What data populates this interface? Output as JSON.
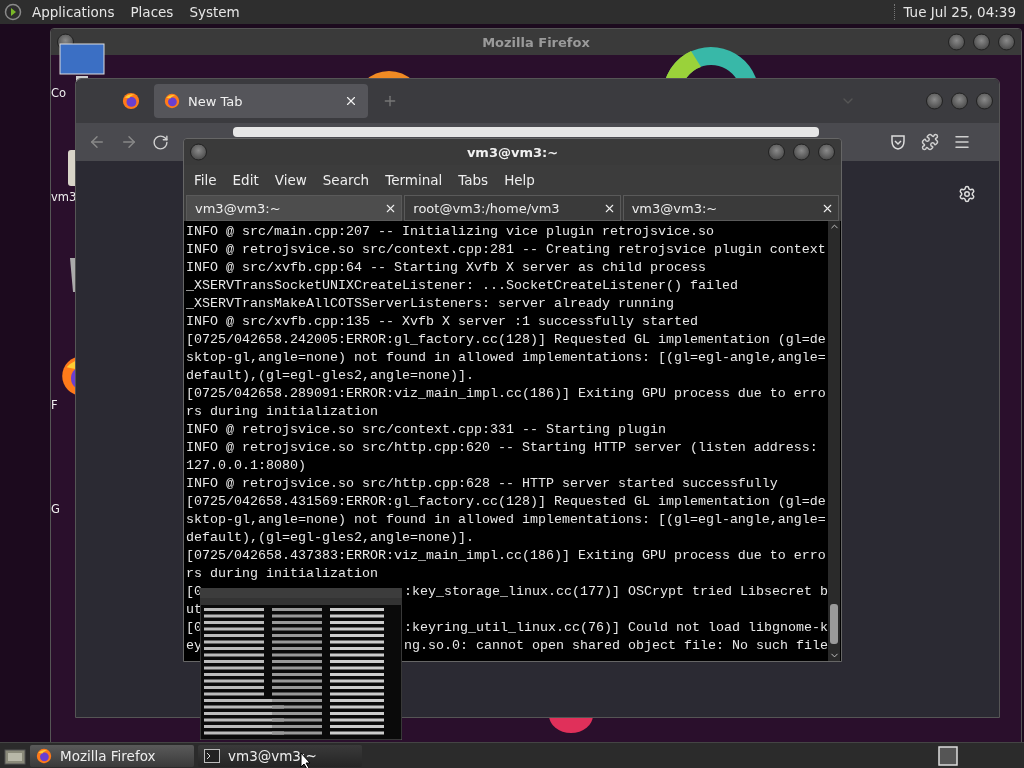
{
  "top_panel": {
    "menus": [
      "Applications",
      "Places",
      "System"
    ],
    "clock": "Tue Jul 25, 04:39"
  },
  "desktop_icons": [
    {
      "kind": "computer",
      "label": "Co"
    },
    {
      "kind": "drive",
      "label": "vm3"
    },
    {
      "kind": "trash"
    },
    {
      "kind": "firefox",
      "label": "F"
    },
    {
      "kind": "blank",
      "label": "G"
    }
  ],
  "back_window": {
    "title": "Mozilla Firefox"
  },
  "firefox": {
    "tabs": [
      {
        "label": "New Tab",
        "selected": true
      }
    ]
  },
  "terminal": {
    "title": "vm3@vm3:~",
    "menu": [
      "File",
      "Edit",
      "View",
      "Search",
      "Terminal",
      "Tabs",
      "Help"
    ],
    "tabs": [
      {
        "label": "vm3@vm3:~",
        "selected": true
      },
      {
        "label": "root@vm3:/home/vm3",
        "selected": false
      },
      {
        "label": "vm3@vm3:~",
        "selected": false
      }
    ],
    "lines": [
      "INFO @ src/main.cpp:207 -- Initializing vice plugin retrojsvice.so",
      "INFO @ retrojsvice.so src/context.cpp:281 -- Creating retrojsvice plugin context",
      "INFO @ src/xvfb.cpp:64 -- Starting Xvfb X server as child process",
      "_XSERVTransSocketUNIXCreateListener: ...SocketCreateListener() failed",
      "_XSERVTransMakeAllCOTSServerListeners: server already running",
      "INFO @ src/xvfb.cpp:135 -- Xvfb X server :1 successfully started",
      "[0725/042658.242005:ERROR:gl_factory.cc(128)] Requested GL implementation (gl=de",
      "sktop-gl,angle=none) not found in allowed implementations: [(gl=egl-angle,angle=",
      "default),(gl=egl-gles2,angle=none)].",
      "[0725/042658.289091:ERROR:viz_main_impl.cc(186)] Exiting GPU process due to erro",
      "rs during initialization",
      "INFO @ retrojsvice.so src/context.cpp:331 -- Starting plugin",
      "INFO @ retrojsvice.so src/http.cpp:620 -- Starting HTTP server (listen address:",
      "127.0.0.1:8080)",
      "INFO @ retrojsvice.so src/http.cpp:628 -- HTTP server started successfully",
      "[0725/042658.431569:ERROR:gl_factory.cc(128)] Requested GL implementation (gl=de",
      "sktop-gl,angle=none) not found in allowed implementations: [(gl=egl-angle,angle=",
      "default),(gl=egl-gles2,angle=none)].",
      "[0725/042658.437383:ERROR:viz_main_impl.cc(186)] Exiting GPU process due to erro",
      "rs during initialization",
      {
        "left": "[0",
        "right": ":key_storage_linux.cc(177)] OSCrypt tried Libsecret b"
      },
      "ut",
      {
        "left": "[0",
        "right": ":keyring_util_linux.cc(76)] Could not load libgnome-k"
      },
      {
        "left": "ey",
        "right": "ng.so.0: cannot open shared object file: No such file"
      }
    ]
  },
  "taskbar": {
    "buttons": [
      {
        "kind": "firefox",
        "label": "Mozilla Firefox",
        "selected": false
      },
      {
        "kind": "terminal",
        "label": "vm3@vm3:~",
        "selected": true
      }
    ]
  }
}
